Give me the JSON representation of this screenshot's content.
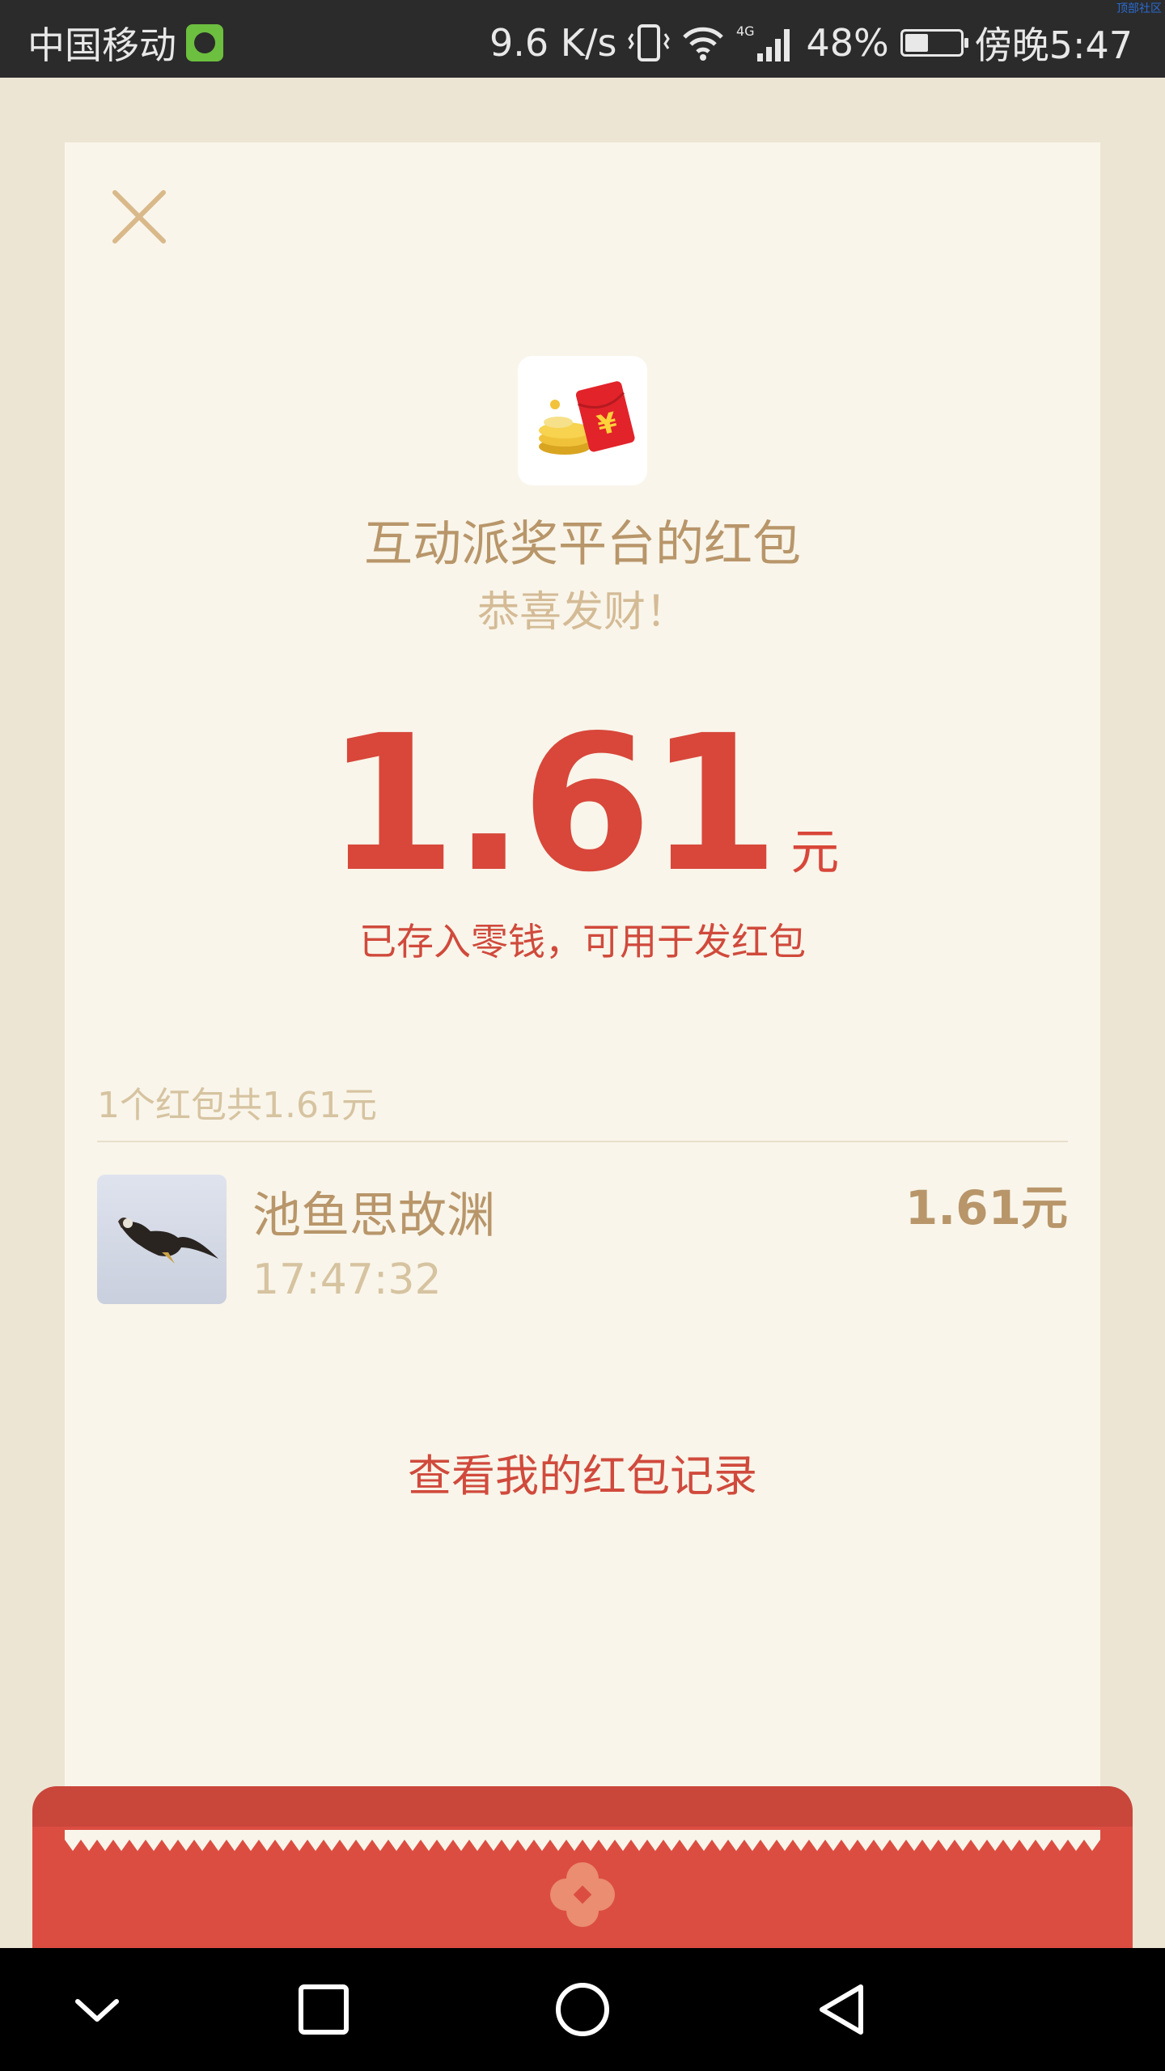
{
  "status_bar": {
    "carrier": "中国移动",
    "speed": "9.6 K/s",
    "network": "4G",
    "battery_percent_label": "48%",
    "battery_level": 0.48,
    "time": "傍晚5:47",
    "corner_tag": "顶部社区"
  },
  "packet": {
    "sender": "互动派奖平台的红包",
    "greeting": "恭喜发财！",
    "amount": "1.61",
    "unit": "元",
    "deposit_note": "已存入零钱，可用于发红包"
  },
  "summary": "1个红包共1.61元",
  "records": [
    {
      "name": "池鱼思故渊",
      "time": "17:47:32",
      "amount": "1.61元"
    }
  ],
  "records_link": "查看我的红包记录",
  "colors": {
    "accent_red": "#d8473a",
    "gold": "#b8966a",
    "card_bg": "#f9f5ea",
    "page_bg": "#ece5d4"
  },
  "icons": {
    "close": "close-icon",
    "app": "red-envelope-coins-icon",
    "nav": [
      "chevron-down-icon",
      "square-recent-icon",
      "circle-home-icon",
      "triangle-back-icon"
    ]
  }
}
